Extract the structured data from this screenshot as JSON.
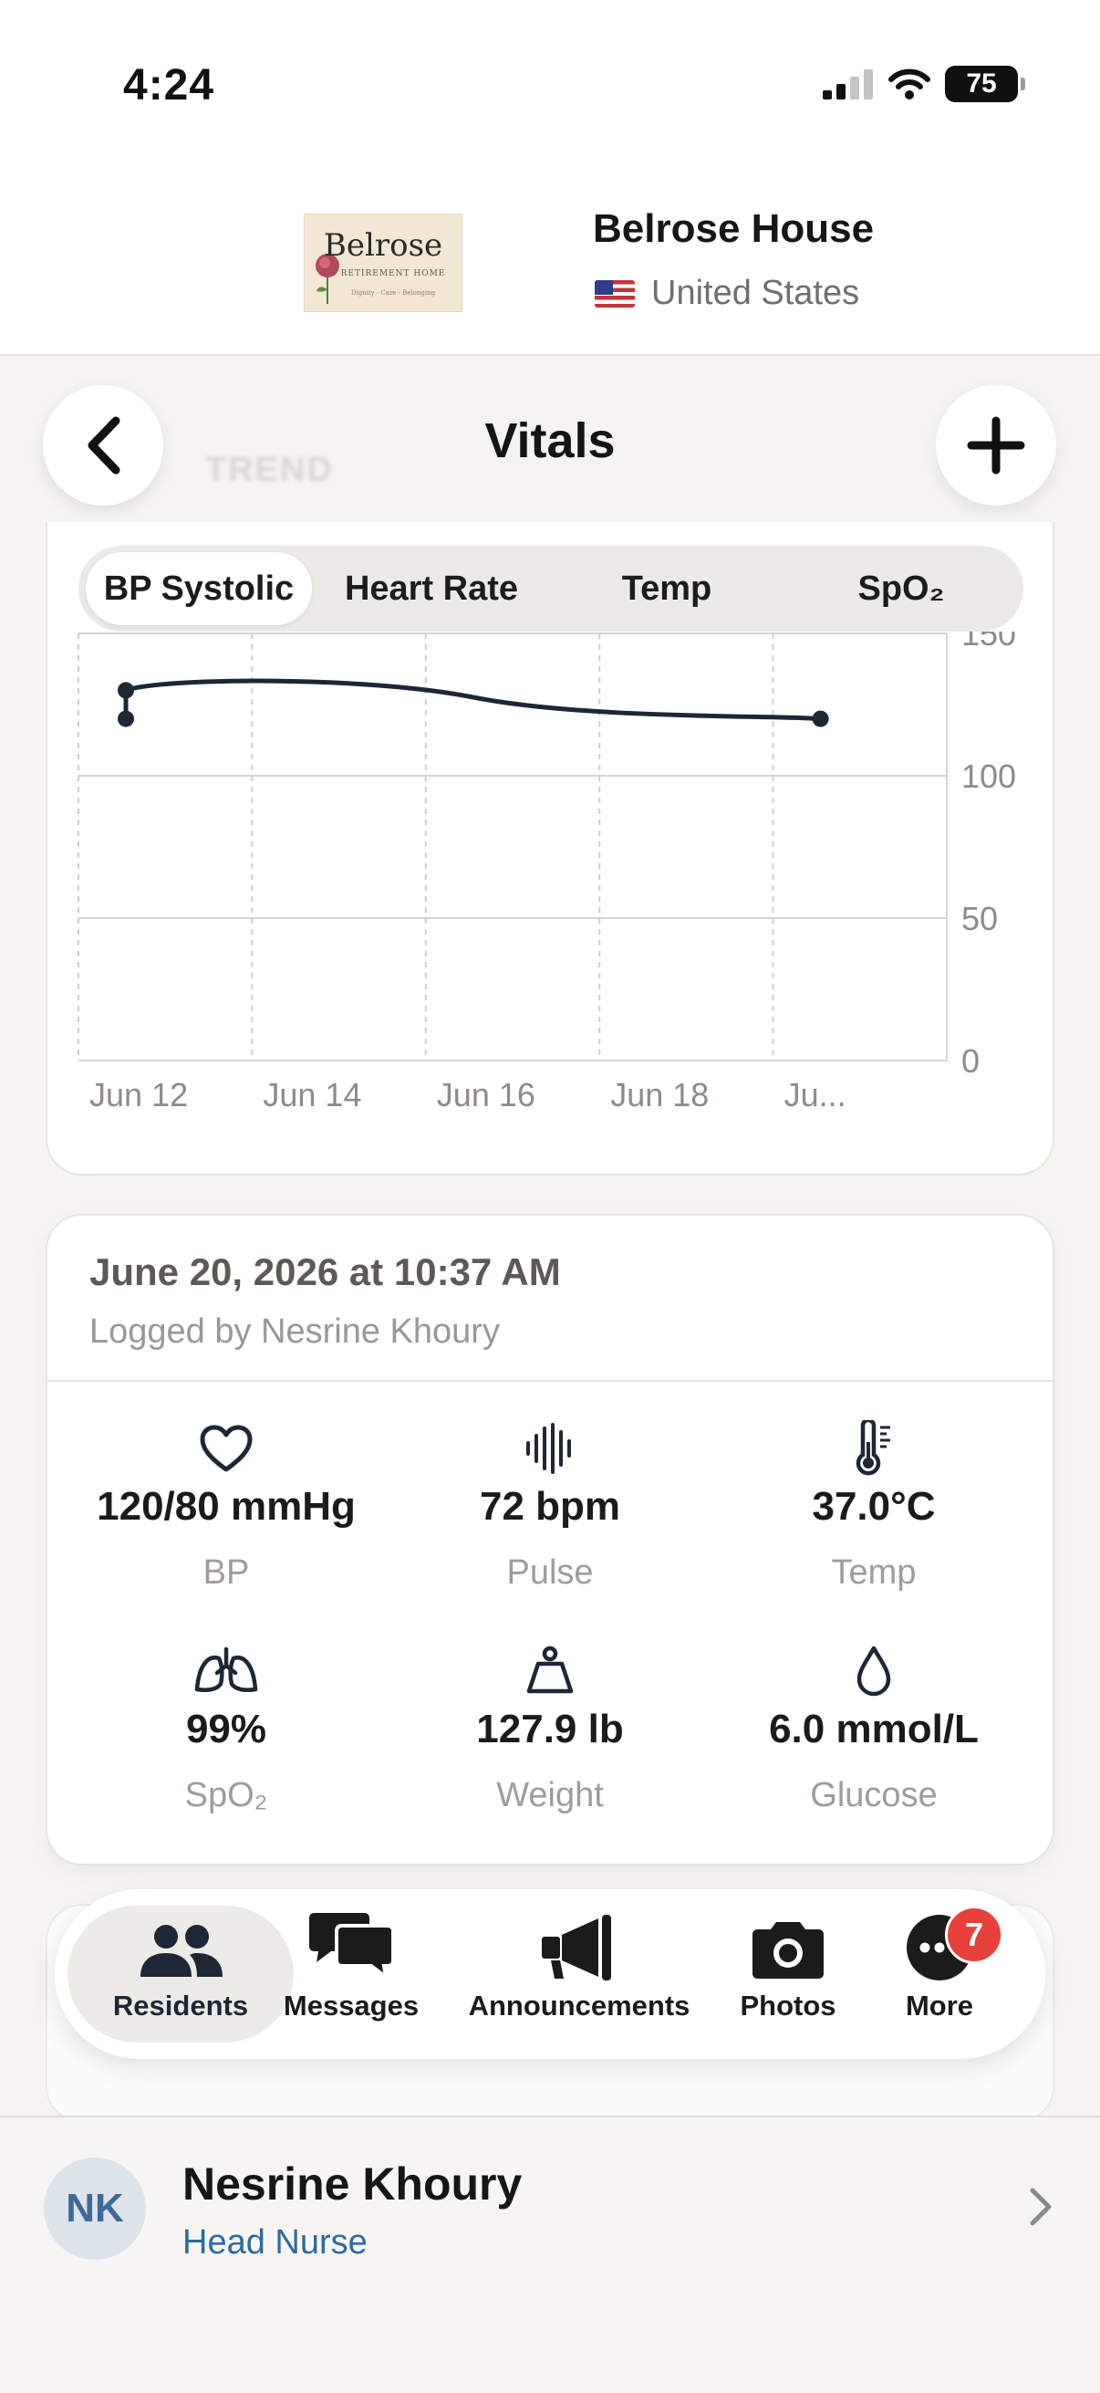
{
  "status_bar": {
    "time": "4:24",
    "battery": "75"
  },
  "facility": {
    "logo_word": "Belrose",
    "logo_sub": "RETIREMENT HOME",
    "logo_tagline": "Dignity · Care · Belonging",
    "name": "Belrose House",
    "country": "United States"
  },
  "nav": {
    "title": "Vitals",
    "ghost_heading": "TREND"
  },
  "metric_tabs": [
    {
      "label": "BP Systolic",
      "active": true
    },
    {
      "label": "Heart Rate",
      "active": false
    },
    {
      "label": "Temp",
      "active": false
    },
    {
      "label": "SpO₂",
      "active": false
    }
  ],
  "chart_data": {
    "type": "line",
    "x_tick_labels": [
      "Jun 12",
      "Jun 14",
      "Jun 16",
      "Jun 18",
      "Ju..."
    ],
    "y_tick_labels": [
      "150",
      "100",
      "50",
      "0"
    ],
    "ylim": [
      0,
      150
    ],
    "grid": true,
    "series": [
      {
        "points": [
          {
            "x": "Jun 12",
            "y": 120
          },
          {
            "x": "Jun 12",
            "y": 130
          },
          {
            "x": "Jun 20",
            "y": 120
          }
        ]
      }
    ]
  },
  "entry": {
    "date": "June 20, 2026 at 10:37 AM",
    "logged_by": "Logged by Nesrine Khoury",
    "vitals": [
      {
        "icon": "heart-icon",
        "value": "120/80 mmHg",
        "label": "BP"
      },
      {
        "icon": "pulse-wave-icon",
        "value": "72 bpm",
        "label": "Pulse"
      },
      {
        "icon": "thermometer-icon",
        "value": "37.0°C",
        "label": "Temp"
      },
      {
        "icon": "lungs-icon",
        "value": "99%",
        "label": "SpO₂"
      },
      {
        "icon": "weight-icon",
        "value": "127.9 lb",
        "label": "Weight"
      },
      {
        "icon": "drop-icon",
        "value": "6.0 mmol/L",
        "label": "Glucose"
      }
    ]
  },
  "tab_bar": {
    "tabs": [
      {
        "label": "Residents",
        "icon": "people-icon",
        "active": true
      },
      {
        "label": "Messages",
        "icon": "chat-bubbles-icon",
        "active": false
      },
      {
        "label": "Announcements",
        "icon": "megaphone-icon",
        "active": false
      },
      {
        "label": "Photos",
        "icon": "camera-icon",
        "active": false
      },
      {
        "label": "More",
        "icon": "more-icon",
        "active": false,
        "badge": "7"
      }
    ]
  },
  "user": {
    "initials": "NK",
    "name": "Nesrine Khoury",
    "role": "Head Nurse"
  },
  "colors": {
    "line": "#1d2736",
    "accent_blue": "#2f6a9e",
    "badge_red": "#e8413d"
  }
}
